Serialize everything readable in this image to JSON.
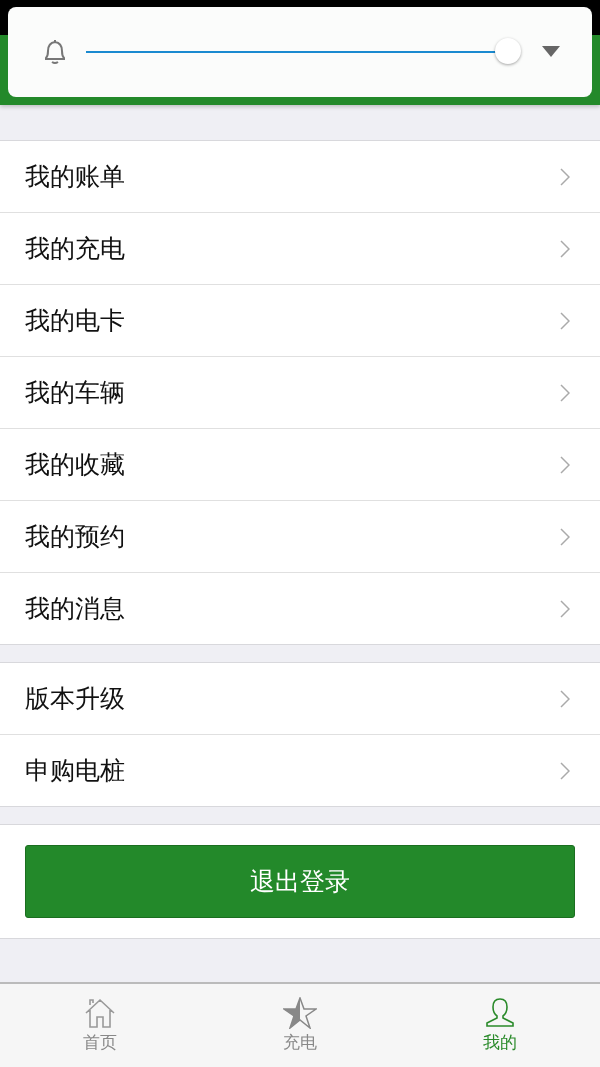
{
  "volume_popup": {
    "level": 1
  },
  "menu_groups": [
    {
      "items": [
        "我的账单",
        "我的充电",
        "我的电卡",
        "我的车辆",
        "我的收藏",
        "我的预约",
        "我的消息"
      ]
    },
    {
      "items": [
        "版本升级",
        "申购电桩"
      ]
    }
  ],
  "logout_button": "退出登录",
  "tabs": [
    {
      "label": "首页",
      "kind": "home",
      "selected": false
    },
    {
      "label": "充电",
      "kind": "charge",
      "selected": false
    },
    {
      "label": "我的",
      "kind": "profile",
      "selected": true
    }
  ]
}
